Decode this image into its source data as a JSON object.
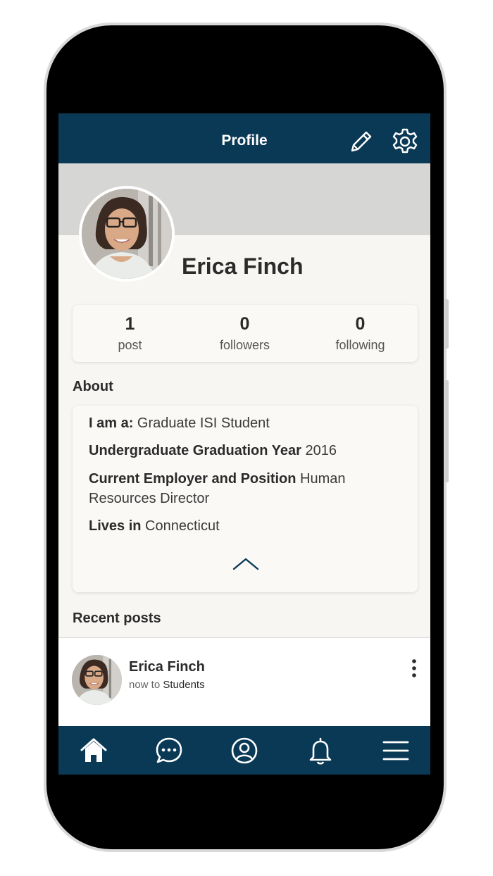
{
  "header": {
    "title": "Profile",
    "edit_icon": "pencil-icon",
    "settings_icon": "gear-icon"
  },
  "profile": {
    "name": "Erica Finch",
    "stats": [
      {
        "value": "1",
        "label": "post"
      },
      {
        "value": "0",
        "label": "followers"
      },
      {
        "value": "0",
        "label": "following"
      }
    ]
  },
  "about": {
    "title": "About",
    "fields": [
      {
        "label": "I am a:",
        "value": "Graduate ISI Student"
      },
      {
        "label": "Undergraduate Graduation Year",
        "value": "2016"
      },
      {
        "label": "Current Employer and Position",
        "value": "Human Resources Director"
      },
      {
        "label": "Lives in",
        "value": "Connecticut"
      }
    ],
    "collapse_icon": "chevron-up-icon"
  },
  "recent_posts": {
    "title": "Recent posts",
    "post": {
      "author": "Erica Finch",
      "time": "now to",
      "group": "Students",
      "menu_icon": "more-vertical-icon"
    }
  },
  "bottom_nav": [
    {
      "name": "home-icon"
    },
    {
      "name": "chat-icon"
    },
    {
      "name": "profile-icon"
    },
    {
      "name": "bell-icon"
    },
    {
      "name": "menu-icon"
    }
  ],
  "colors": {
    "primary": "#0a3956",
    "background": "#f7f6f2",
    "cover": "#d6d6d4"
  }
}
